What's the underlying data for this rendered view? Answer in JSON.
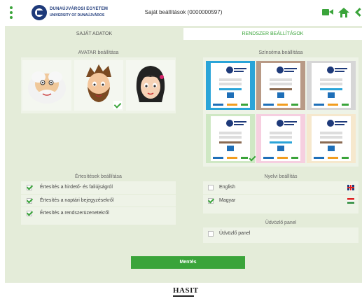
{
  "header": {
    "title": "Saját beállítások (0000000597)",
    "logo_line1": "DUNAÚJVÁROSI EGYETEM",
    "logo_line2": "UNIVERSITY OF DUNAÚJVÁROS",
    "icons": [
      "menu-dots-icon",
      "video-camera-icon",
      "home-icon",
      "back-arrow-icon"
    ],
    "accent": "#3aa43a"
  },
  "tabs": [
    {
      "label": "SAJÁT ADATOK",
      "active": false
    },
    {
      "label": "RENDSZER BEÁLLÍTÁSOK",
      "active": true
    }
  ],
  "avatar": {
    "heading": "AVATAR beállítása",
    "options": [
      {
        "name": "old-scientist-avatar",
        "selected": false
      },
      {
        "name": "bearded-man-avatar",
        "selected": true
      },
      {
        "name": "dark-haired-woman-avatar",
        "selected": false
      }
    ]
  },
  "theme": {
    "heading": "Színséma beállítása",
    "options": [
      {
        "color": "#2aa4d8",
        "selected": false
      },
      {
        "color": "#b89a86",
        "selected": false
      },
      {
        "color": "#d6d6d6",
        "selected": false
      },
      {
        "color": "#cfe8c4",
        "selected": true
      },
      {
        "color": "#f6cfe0",
        "selected": false
      },
      {
        "color": "#f6e8cd",
        "selected": false
      }
    ]
  },
  "notifications": {
    "heading": "Értesítések beállítása",
    "items": [
      {
        "label": "Értesítés a hirdető- és faliújságról",
        "checked": true
      },
      {
        "label": "Értesítés a naptári bejegyzésekről",
        "checked": true
      },
      {
        "label": "Értesítés a rendszerüzenetekről",
        "checked": true
      }
    ]
  },
  "language": {
    "heading": "Nyelvi beállítás",
    "items": [
      {
        "label": "English",
        "checked": false,
        "flag": "uk-flag-icon"
      },
      {
        "label": "Magyar",
        "checked": true,
        "flag": "hungary-flag-icon"
      }
    ]
  },
  "welcome": {
    "heading": "Üdvözlő panel",
    "label": "Üdvözlő panel",
    "checked": false
  },
  "save_label": "Mentés",
  "footer": {
    "logo_text": "HASIT"
  }
}
